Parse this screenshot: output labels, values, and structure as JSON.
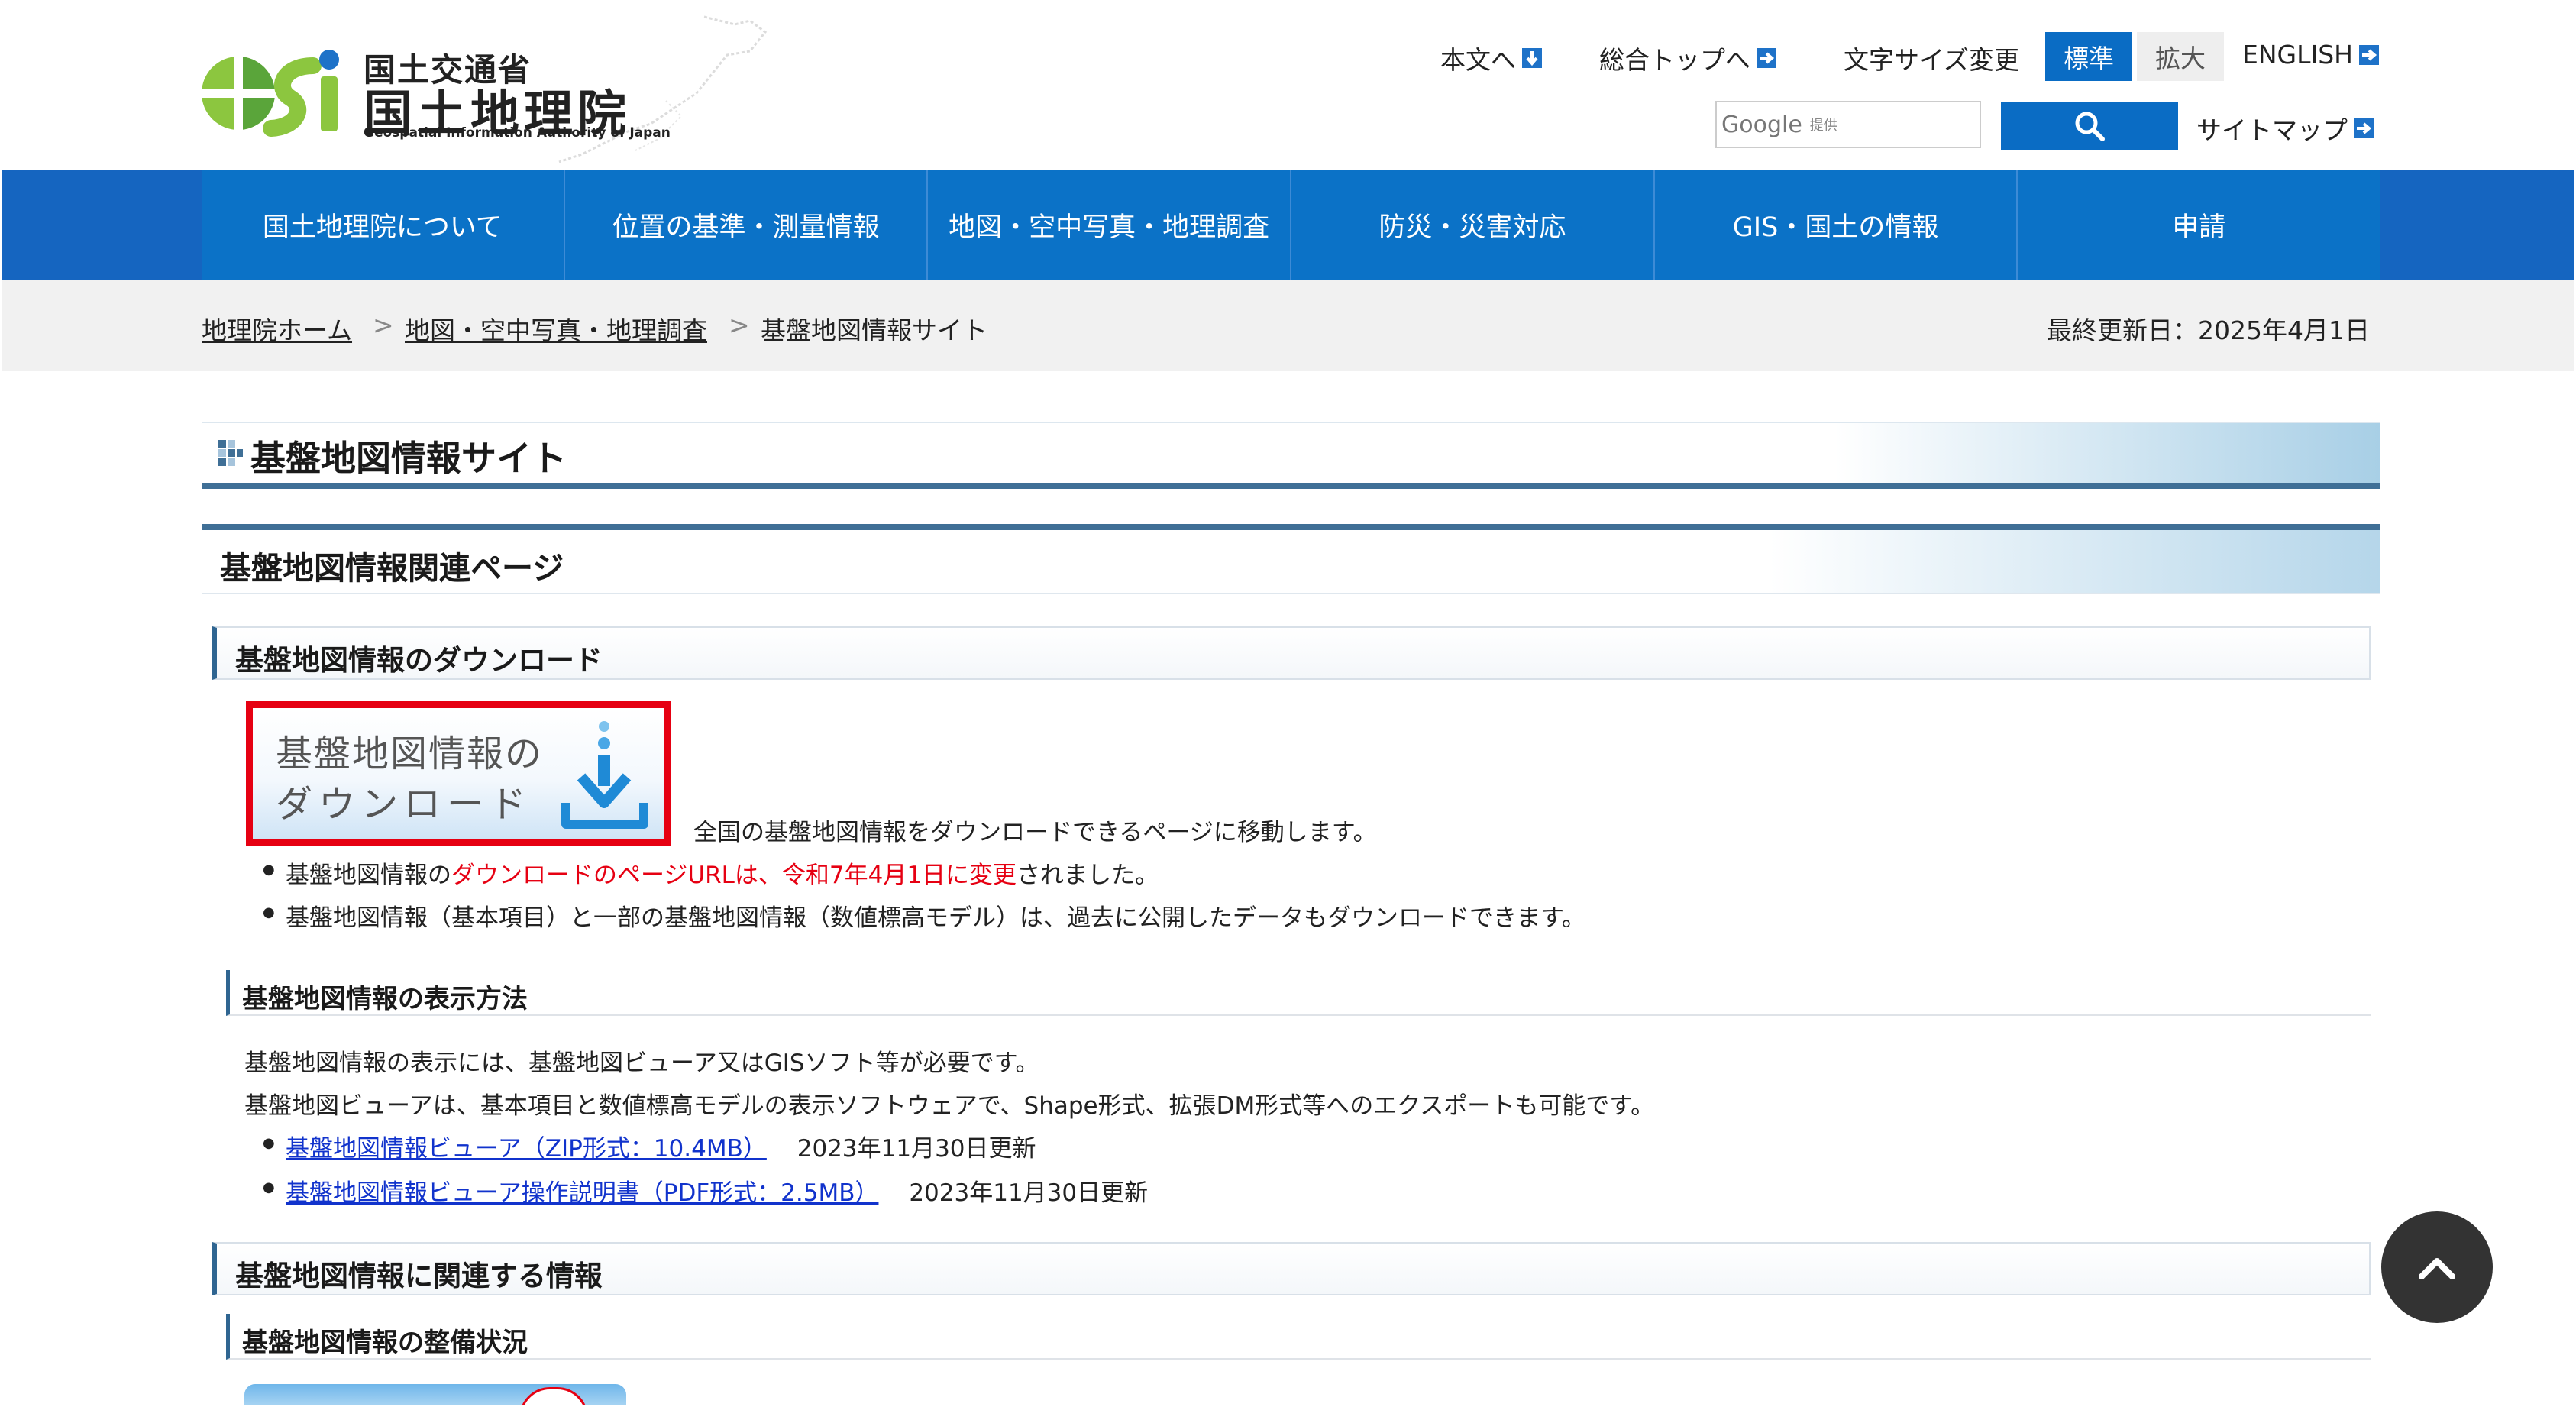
{
  "header": {
    "logo_ministry": "国土交通省",
    "logo_name": "国土地理院",
    "logo_english": "Geospatial Information Authority of Japan",
    "links": {
      "skip_to_content": "本文へ",
      "general_top": "総合トップへ",
      "text_size_label": "文字サイズ変更",
      "size_standard": "標準",
      "size_large": "拡大",
      "english": "ENGLISH",
      "sitemap": "サイトマップ"
    },
    "search": {
      "brand": "Google",
      "provided": "提供"
    }
  },
  "nav": {
    "items": [
      {
        "label": "国土地理院について"
      },
      {
        "label": "位置の基準・測量情報"
      },
      {
        "label": "地図・空中写真・地理調査"
      },
      {
        "label": "防災・災害対応"
      },
      {
        "label": "GIS・国土の情報"
      },
      {
        "label": "申請"
      }
    ]
  },
  "breadcrumb": {
    "home": "地理院ホーム",
    "parent": "地図・空中写真・地理調査",
    "current": "基盤地図情報サイト",
    "separator": ">",
    "updated": "最終更新日：2025年4月1日"
  },
  "main": {
    "page_title": "基盤地図情報サイト",
    "related_heading": "基盤地図情報関連ページ",
    "download_heading": "基盤地図情報のダウンロード",
    "banner": {
      "line1": "基盤地図情報の",
      "line2": "ダウンロード"
    },
    "banner_caption": "全国の基盤地図情報をダウンロードできるページに移動します。",
    "notice1": {
      "prefix": "基盤地図情報の",
      "highlight": "ダウンロードのページURLは、令和7年4月1日に変更",
      "suffix": "されました。"
    },
    "notice2": "基盤地図情報（基本項目）と一部の基盤地図情報（数値標高モデル）は、過去に公開したデータもダウンロードできます。",
    "display_heading": "基盤地図情報の表示方法",
    "display_p1": "基盤地図情報の表示には、基盤地図ビューア又はGISソフト等が必要です。",
    "display_p2": "基盤地図ビューアは、基本項目と数値標高モデルの表示ソフトウェアで、Shape形式、拡張DM形式等へのエクスポートも可能です。",
    "viewer_link": "基盤地図情報ビューア（ZIP形式：10.4MB）",
    "viewer_date": "2023年11月30日更新",
    "manual_link": "基盤地図情報ビューア操作説明書（PDF形式：2.5MB）",
    "manual_date": "2023年11月30日更新",
    "related_info_heading": "基盤地図情報に関連する情報",
    "status_heading": "基盤地図情報の整備状況"
  },
  "colors": {
    "nav_blue": "#0b72c7",
    "heading_rule": "#3f6f96",
    "alert_red": "#e60012",
    "link_blue": "#1133cc"
  }
}
